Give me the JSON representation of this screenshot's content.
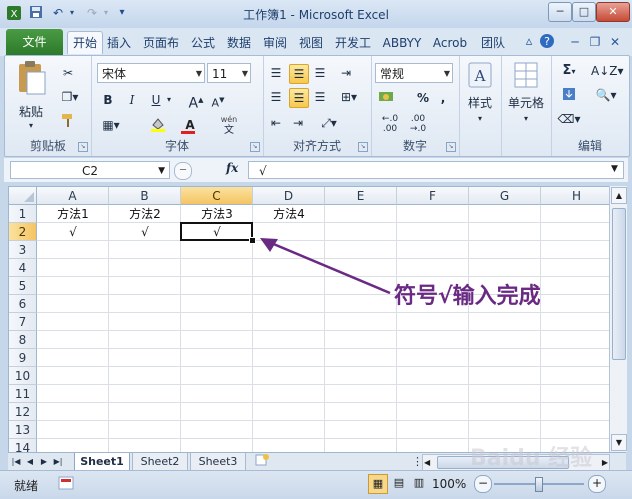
{
  "window": {
    "title": "工作簿1 - Microsoft Excel"
  },
  "tabs": {
    "file": "文件",
    "items": [
      "开始",
      "插入",
      "页面布",
      "公式",
      "数据",
      "审阅",
      "视图",
      "开发工",
      "ABBYY",
      "Acrob",
      "团队"
    ]
  },
  "ribbon": {
    "clipboard": {
      "label": "剪贴板",
      "paste": "粘贴"
    },
    "font": {
      "label": "字体",
      "name": "宋体",
      "size": "11",
      "bold": "B",
      "italic": "I",
      "underline": "U",
      "grow": "A",
      "shrink": "A",
      "color": "A",
      "phonetic": "wén"
    },
    "alignment": {
      "label": "对齐方式"
    },
    "number": {
      "label": "数字",
      "format": "常规",
      "percent": "%",
      "comma": ","
    },
    "styles": {
      "label": "样式"
    },
    "cells": {
      "label": "单元格"
    },
    "editing": {
      "label": "编辑",
      "sum": "Σ"
    }
  },
  "formula_bar": {
    "name_box": "C2",
    "fx": "fx",
    "content": "√"
  },
  "grid": {
    "columns": [
      "A",
      "B",
      "C",
      "D",
      "E",
      "F",
      "G",
      "H"
    ],
    "rows": [
      "1",
      "2",
      "3",
      "4",
      "5",
      "6",
      "7",
      "8",
      "9",
      "10",
      "11",
      "12",
      "13",
      "14"
    ],
    "row1": [
      "方法1",
      "方法2",
      "方法3",
      "方法4"
    ],
    "row2": [
      "√",
      "√",
      "√"
    ]
  },
  "sheets": [
    "Sheet1",
    "Sheet2",
    "Sheet3"
  ],
  "status": {
    "mode": "就绪",
    "zoom": "100%"
  },
  "annotation": "符号√输入完成",
  "watermark": "Baidu 经验",
  "colors": {
    "file_tab": "#2d7a2b",
    "active_cell_header": "#f5c462",
    "annotation": "#6a2a84"
  }
}
